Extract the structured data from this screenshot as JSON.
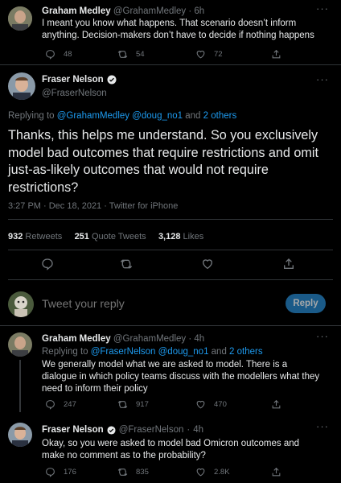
{
  "tweet1": {
    "name": "Graham Medley",
    "handle": "@GrahamMedley",
    "sep": "·",
    "time": "6h",
    "text": "I meant you know what happens. That scenario doesn’t inform anything. Decision-makers don’t have to decide if nothing happens",
    "replies": "48",
    "retweets": "54",
    "likes": "72"
  },
  "main": {
    "name": "Fraser Nelson",
    "handle": "@FraserNelson",
    "replying_prefix": "Replying to ",
    "replying_users": "@GrahamMedley @doug_no1",
    "replying_and": " and ",
    "replying_others": "2 others",
    "text": "Thanks, this helps me understand. So you exclusively model bad outcomes that require restrictions and omit just-as-likely outcomes that would not require restrictions?",
    "meta_time": "3:27 PM · Dec 18, 2021 · ",
    "meta_source": "Twitter for iPhone",
    "retweets_count": "932",
    "retweets_label": "Retweets",
    "quotes_count": "251",
    "quotes_label": "Quote Tweets",
    "likes_count": "3,128",
    "likes_label": "Likes"
  },
  "compose": {
    "placeholder": "Tweet your reply",
    "button": "Reply"
  },
  "reply1": {
    "name": "Graham Medley",
    "handle": "@GrahamMedley",
    "sep": "·",
    "time": "4h",
    "replying_prefix": "Replying to ",
    "replying_users": "@FraserNelson @doug_no1",
    "replying_and": " and ",
    "replying_others": "2 others",
    "text": "We generally model what we are asked to model. There is a dialogue in which policy teams discuss with the modellers what they need to inform their policy",
    "replies": "247",
    "retweets": "917",
    "likes": "470"
  },
  "reply2": {
    "name": "Fraser Nelson",
    "handle": "@FraserNelson",
    "sep": "·",
    "time": "4h",
    "text": "Okay, so you were asked to model bad Omicron outcomes and make no comment as to the probability?",
    "replies": "176",
    "retweets": "835",
    "likes": "2.8K"
  },
  "colors": {
    "background": "#000000",
    "accent": "#1d9bf0",
    "text": "#e7e9ea",
    "muted": "#71767b",
    "border": "#2f3336"
  },
  "icons": [
    "reply-icon",
    "retweet-icon",
    "like-icon",
    "share-icon",
    "verified-icon",
    "more-icon"
  ]
}
